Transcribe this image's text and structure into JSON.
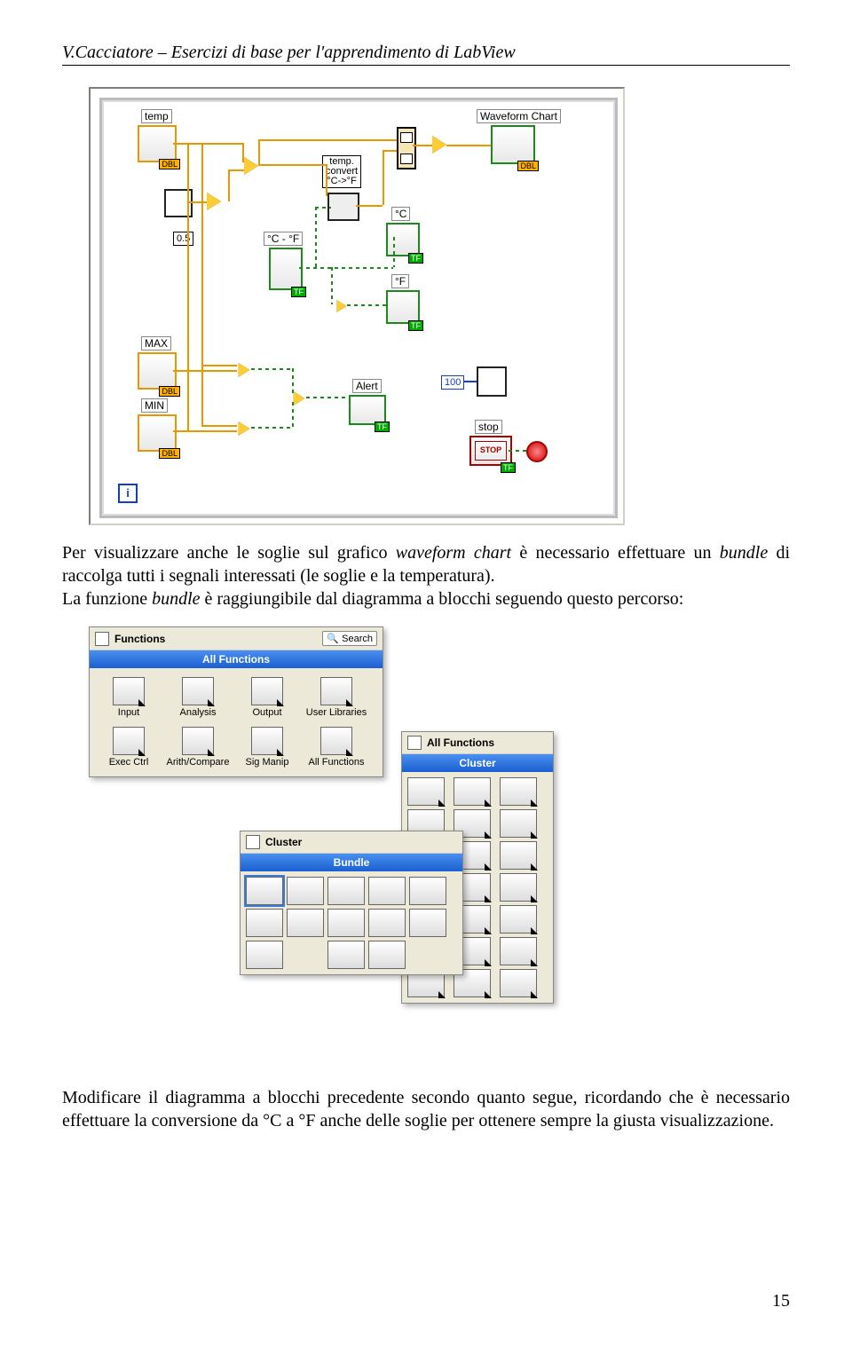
{
  "header": "V.Cacciatore – Esercizi di base per l'apprendimento di LabView",
  "para1_a": "Per visualizzare anche le soglie sul grafico ",
  "para1_it1": "waveform chart",
  "para1_b": " è necessario effettuare un ",
  "para1_it2": "bundle",
  "para1_c": " di raccolga tutti i segnali interessati (le soglie e la temperatura).",
  "para2_a": "La funzione ",
  "para2_it1": "bundle",
  "para2_b": " è raggiungibile dal diagramma a blocchi seguendo questo percorso:",
  "para3": "Modificare il diagramma a blocchi precedente secondo quanto segue, ricordando che è necessario effettuare la conversione da °C a °F anche delle soglie per ottenere sempre la giusta visualizzazione.",
  "page_number": "15",
  "bd": {
    "temp": "temp",
    "wf": "Waveform Chart",
    "const05": "0.5",
    "convert": "temp.\nconvert\n°C->°F",
    "cf_switch": "°C - °F",
    "degC": "°C",
    "degF": "°F",
    "MAX": "MAX",
    "MIN": "MIN",
    "Alert": "Alert",
    "hundred": "100",
    "stop": "stop",
    "stop_btn": "STOP",
    "i": "i",
    "DBL": "DBL",
    "TF": "TF"
  },
  "palettes": {
    "functions": {
      "title_left": "Functions",
      "search": "Search",
      "bar": "All Functions",
      "items": [
        "Input",
        "Analysis",
        "Output",
        "User Libraries",
        "Exec Ctrl",
        "Arith/Compare",
        "Sig Manip",
        "All Functions"
      ]
    },
    "allfun": {
      "title": "All Functions",
      "sub": "Cluster"
    },
    "cluster": {
      "title": "Cluster",
      "sub": "Bundle"
    }
  }
}
